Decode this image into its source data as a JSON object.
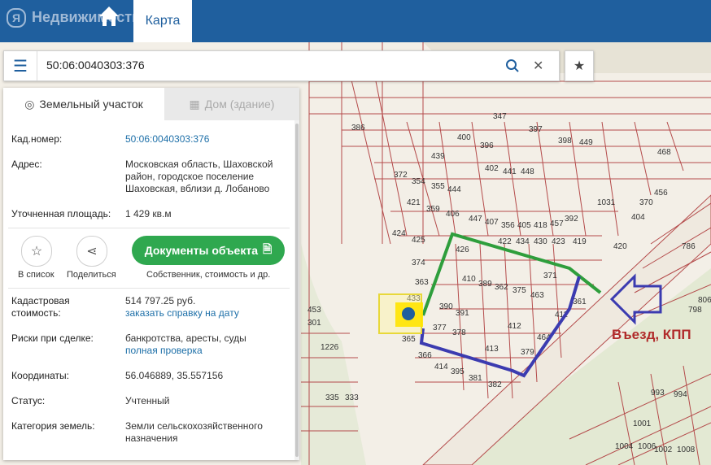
{
  "header": {
    "brand": "Недвижимость",
    "tab_map": "Карта"
  },
  "search": {
    "value": "50:06:0040303:376"
  },
  "panel": {
    "tab_land": "Земельный участок",
    "tab_house": "Дом (здание)",
    "cad_label": "Кад.номер:",
    "cad_value": "50:06:0040303:376",
    "address_label": "Адрес:",
    "address_line1": "Московская область, Шаховской",
    "address_line2": "район, городское поселение",
    "address_line3": "Шаховская, вблизи д. Лобаново",
    "area_label": "Уточненная площадь:",
    "area_value": "1 429 кв.м",
    "btn_list": "В список",
    "btn_share": "Поделиться",
    "btn_docs": "Документы объекта",
    "docs_sub": "Собственник, стоимость и др.",
    "cost_label1": "Кадастровая",
    "cost_label2": "стоимость:",
    "cost_value": "514 797.25 руб.",
    "cost_link": "заказать справку на дату",
    "risks_label": "Риски при сделке:",
    "risks_value": "банкротства, аресты, суды",
    "risks_link": "полная проверка",
    "coords_label": "Координаты:",
    "coords_value": "56.046889, 35.557156",
    "status_label": "Статус:",
    "status_value": "Учтенный",
    "category_label": "Категория земель:",
    "category_line1": "Земли сельскохозяйственного",
    "category_line2": "назначения"
  },
  "map": {
    "entry_label": "Въезд, КПП",
    "parcel_numbers": [
      "386",
      "439",
      "400",
      "372",
      "354",
      "355",
      "444",
      "396",
      "402",
      "441",
      "448",
      "421",
      "359",
      "406",
      "447",
      "407",
      "356",
      "405",
      "418",
      "457",
      "392",
      "363",
      "424",
      "425",
      "374",
      "433",
      "390",
      "391",
      "377",
      "378",
      "365",
      "366",
      "414",
      "395",
      "381",
      "382",
      "410",
      "389",
      "362",
      "375",
      "463",
      "371",
      "426",
      "422",
      "434",
      "430",
      "423",
      "419",
      "361",
      "379",
      "413",
      "412",
      "464",
      "411",
      "1031",
      "404",
      "370",
      "456",
      "420",
      "786",
      "798",
      "806",
      "993",
      "994",
      "1001",
      "1004",
      "1006",
      "1002",
      "1008",
      "335",
      "333",
      "301",
      "1226",
      "453",
      "347",
      "397",
      "398",
      "449",
      "468"
    ]
  },
  "colors": {
    "header_bg": "#1f5f9e",
    "accent_green": "#2fa84f",
    "link_blue": "#1d6fa8",
    "parcel_line": "#b44b4b",
    "route_green": "#2e9e3c",
    "route_blue": "#3b3bb0"
  }
}
